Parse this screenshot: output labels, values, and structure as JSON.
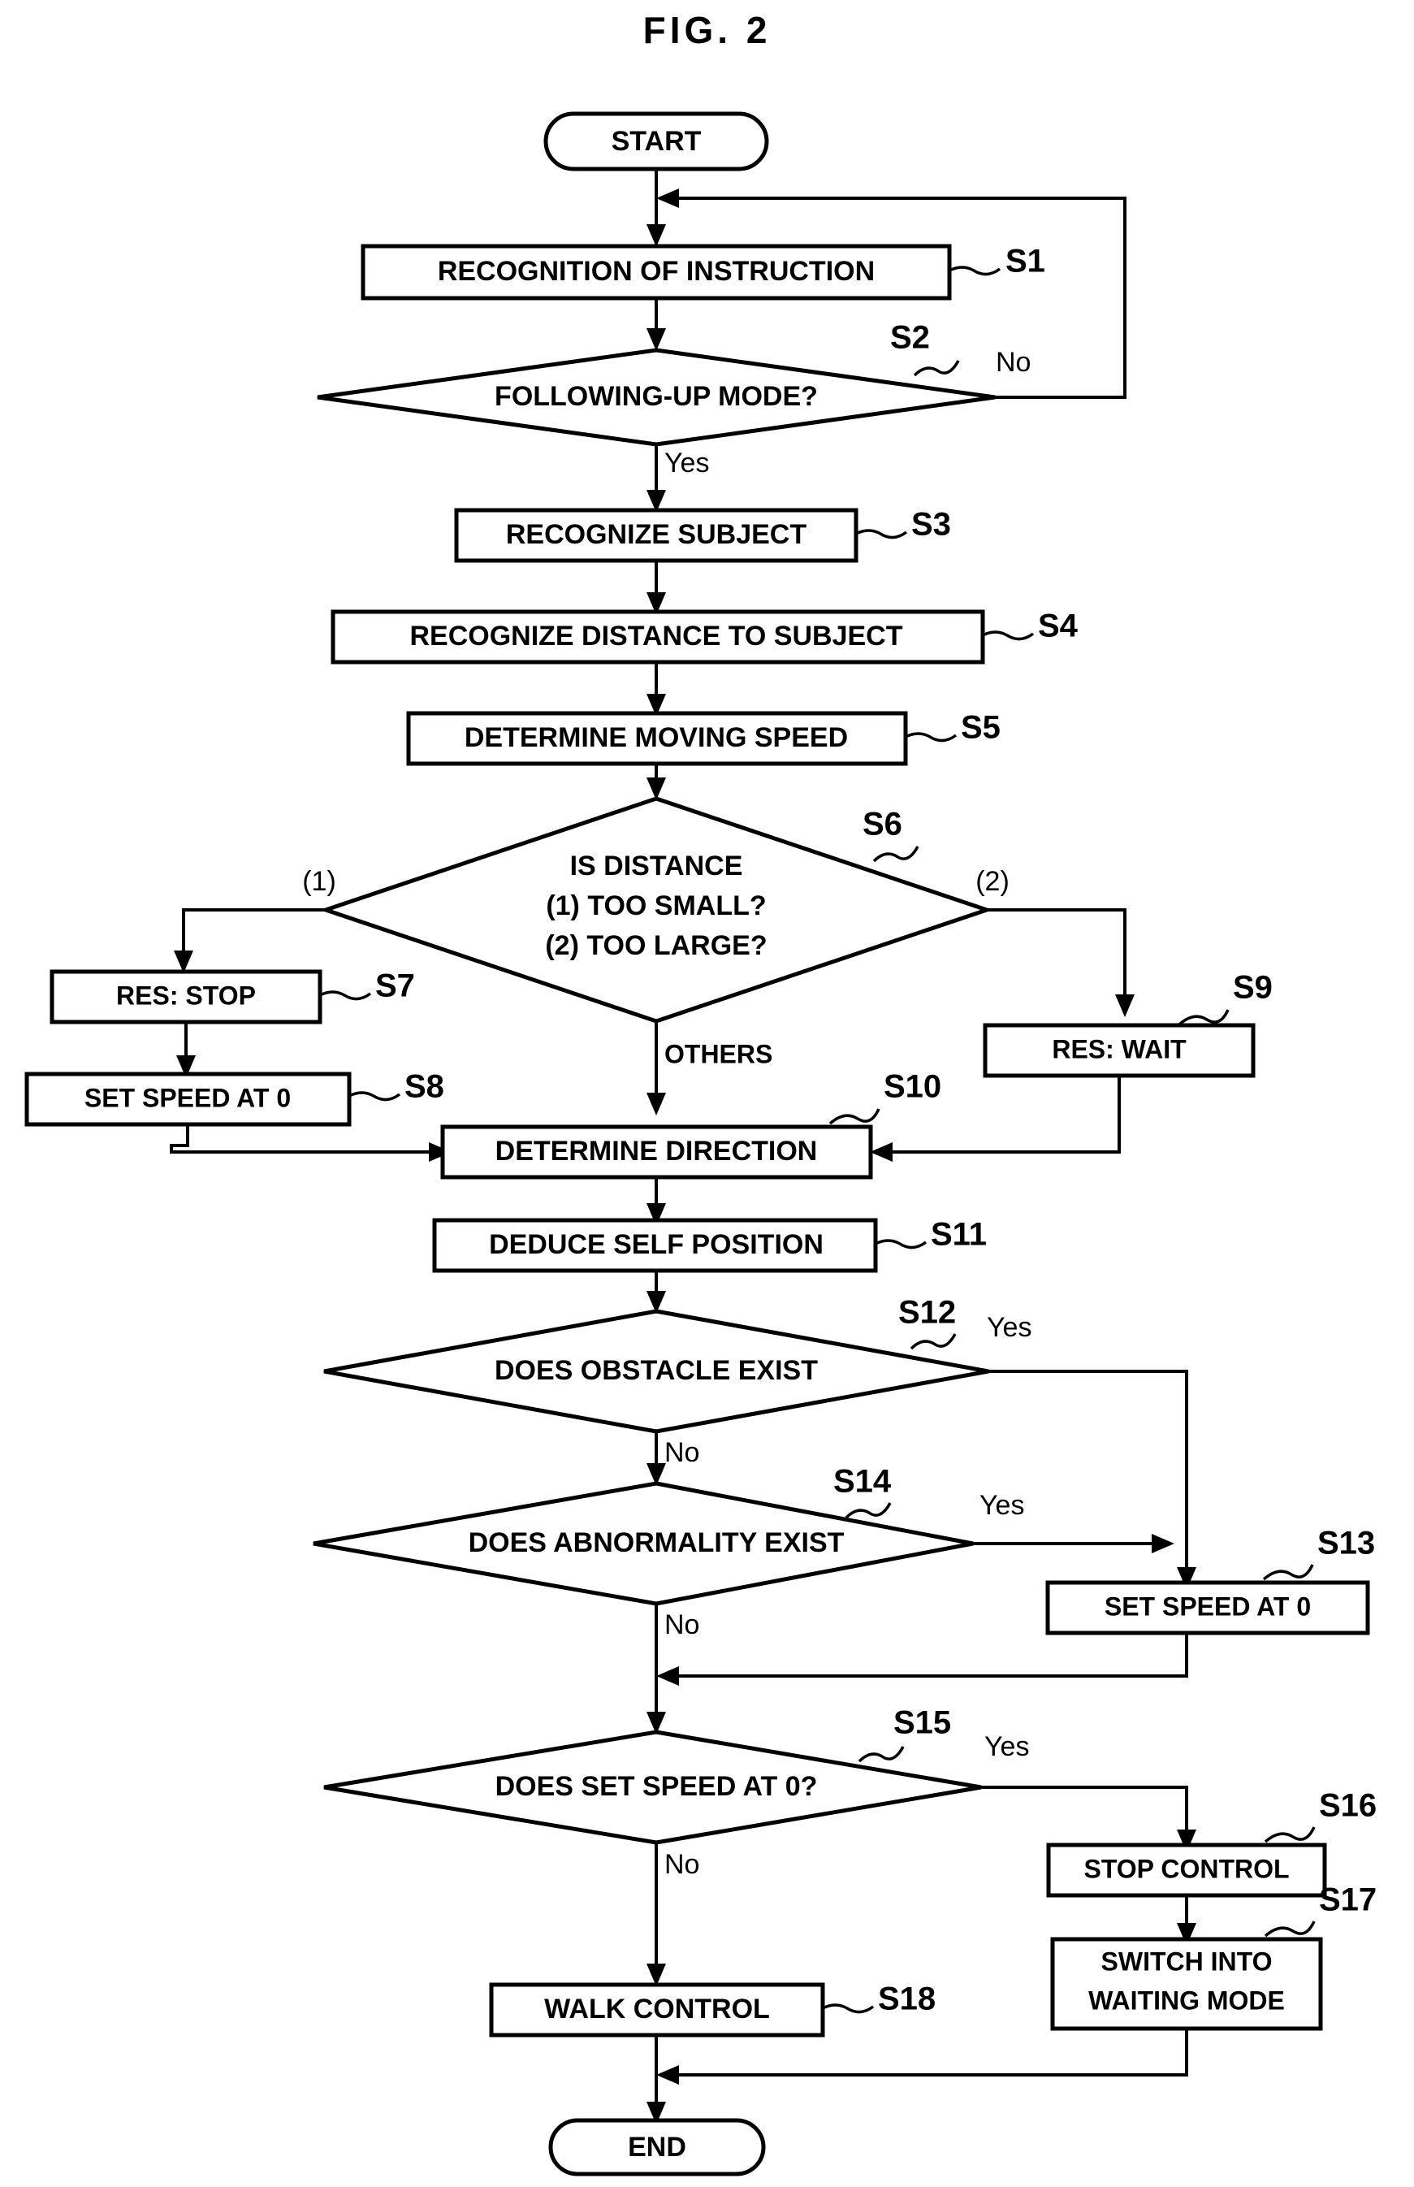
{
  "figure": {
    "title": "FIG. 2",
    "type": "flowchart"
  },
  "nodes": {
    "start": {
      "label": "START",
      "shape": "terminator"
    },
    "s1": {
      "label": "RECOGNITION OF INSTRUCTION",
      "step": "S1",
      "shape": "process"
    },
    "s2": {
      "label": "FOLLOWING-UP MODE?",
      "step": "S2",
      "shape": "decision",
      "yes": "Yes",
      "no": "No"
    },
    "s3": {
      "label": "RECOGNIZE SUBJECT",
      "step": "S3",
      "shape": "process"
    },
    "s4": {
      "label": "RECOGNIZE DISTANCE TO SUBJECT",
      "step": "S4",
      "shape": "process"
    },
    "s5": {
      "label": "DETERMINE MOVING SPEED",
      "step": "S5",
      "shape": "process"
    },
    "s6": {
      "label_line1": "IS DISTANCE",
      "label_line2": "(1) TOO SMALL?",
      "label_line3": "(2) TOO LARGE?",
      "step": "S6",
      "shape": "decision",
      "branch1": "(1)",
      "branch2": "(2)",
      "branch_others": "OTHERS"
    },
    "s7": {
      "label": "RES: STOP",
      "step": "S7",
      "shape": "process"
    },
    "s8": {
      "label": "SET SPEED AT 0",
      "step": "S8",
      "shape": "process"
    },
    "s9": {
      "label": "RES: WAIT",
      "step": "S9",
      "shape": "process"
    },
    "s10": {
      "label": "DETERMINE DIRECTION",
      "step": "S10",
      "shape": "process"
    },
    "s11": {
      "label": "DEDUCE SELF POSITION",
      "step": "S11",
      "shape": "process"
    },
    "s12": {
      "label": "DOES OBSTACLE EXIST",
      "step": "S12",
      "shape": "decision",
      "yes": "Yes",
      "no": "No"
    },
    "s13": {
      "label": "SET SPEED AT 0",
      "step": "S13",
      "shape": "process"
    },
    "s14": {
      "label": "DOES ABNORMALITY EXIST",
      "step": "S14",
      "shape": "decision",
      "yes": "Yes",
      "no": "No"
    },
    "s15": {
      "label": "DOES SET SPEED AT 0?",
      "step": "S15",
      "shape": "decision",
      "yes": "Yes",
      "no": "No"
    },
    "s16": {
      "label": "STOP CONTROL",
      "step": "S16",
      "shape": "process"
    },
    "s17": {
      "label_line1": "SWITCH INTO",
      "label_line2": "WAITING MODE",
      "step": "S17",
      "shape": "process"
    },
    "s18": {
      "label": "WALK CONTROL",
      "step": "S18",
      "shape": "process"
    },
    "end": {
      "label": "END",
      "shape": "terminator"
    }
  },
  "colors": {
    "stroke": "#000000",
    "background": "#ffffff",
    "text": "#000000"
  }
}
